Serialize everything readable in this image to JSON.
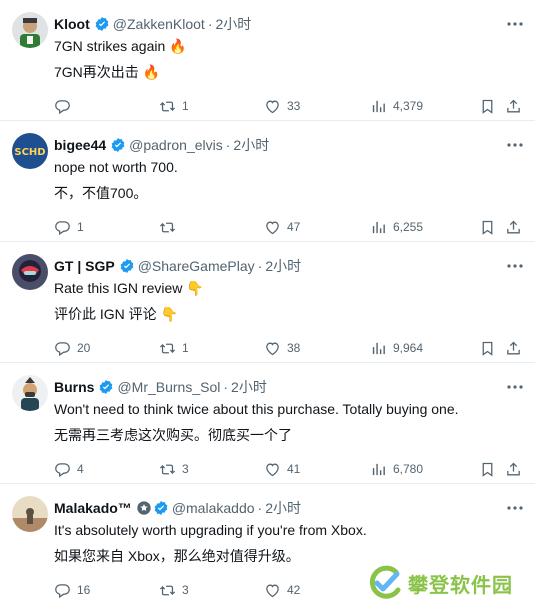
{
  "tweets": [
    {
      "name": "Kloot",
      "handle": "@ZakkenKloot",
      "time": "2小时",
      "line1": "7GN strikes again 🔥",
      "line2": "7GN再次出击 🔥",
      "replies": "",
      "retweets": "1",
      "likes": "33",
      "views": "4,379",
      "avatar_color": "#c9cfd3"
    },
    {
      "name": "bigee44",
      "handle": "@padron_elvis",
      "time": "2小时",
      "line1": "nope not worth 700.",
      "line2": "不，不值700。",
      "replies": "1",
      "retweets": "",
      "likes": "47",
      "views": "6,255",
      "avatar_text": "SCHD",
      "avatar_color": "#1d4f91"
    },
    {
      "name": "GT | SGP",
      "handle": "@ShareGamePlay",
      "time": "2小时",
      "line1": "Rate this IGN review 👇",
      "line2": "评价此 IGN 评论 👇",
      "replies": "20",
      "retweets": "1",
      "likes": "38",
      "views": "9,964",
      "avatar_color": "#2b2d42"
    },
    {
      "name": "Burns",
      "handle": "@Mr_Burns_Sol",
      "time": "2小时",
      "line1": "Won't need to think twice about this purchase. Totally buying one.",
      "line2": "无需再三考虑这次购买。彻底买一个了",
      "replies": "4",
      "retweets": "3",
      "likes": "41",
      "views": "6,780",
      "avatar_color": "#e8eaed"
    },
    {
      "name": "Malakado™",
      "handle": "@malakaddo",
      "time": "2小时",
      "line1": "It's absolutely worth upgrading if you're from Xbox.",
      "line2": "如果您来自 Xbox，那么绝对值得升级。",
      "replies": "16",
      "retweets": "3",
      "likes": "42",
      "views": "",
      "avatar_color": "#d9c7a7"
    }
  ],
  "watermark": {
    "text": "攀登软件园"
  },
  "colors": {
    "verified": "#1d9bf0",
    "muted": "#536471",
    "text": "#0f1419"
  }
}
